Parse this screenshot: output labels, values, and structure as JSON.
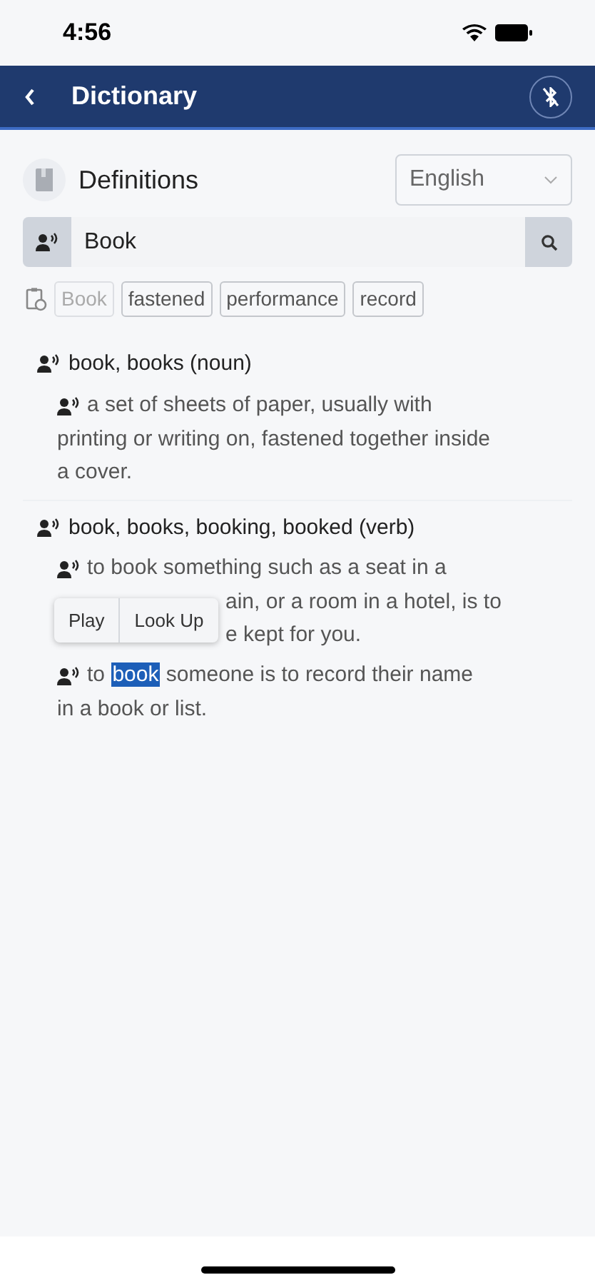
{
  "status_bar": {
    "time": "4:56"
  },
  "header": {
    "title": "Dictionary"
  },
  "section": {
    "title": "Definitions",
    "language": "English"
  },
  "search": {
    "value": "Book"
  },
  "history": [
    {
      "label": "Book",
      "selected": true
    },
    {
      "label": "fastened",
      "selected": false
    },
    {
      "label": "performance",
      "selected": false
    },
    {
      "label": "record",
      "selected": false
    }
  ],
  "entries": [
    {
      "heading": "book, books (noun)",
      "definitions": [
        {
          "lines": [
            {
              "segments": [
                {
                  "text": "a set of sheets of paper, usually with",
                  "selected": false
                }
              ]
            },
            {
              "segments": [
                {
                  "text": "printing or writing on, fastened together inside",
                  "selected": false
                }
              ]
            },
            {
              "segments": [
                {
                  "text": "a cover.",
                  "selected": false
                }
              ]
            }
          ]
        }
      ]
    },
    {
      "heading": "book, books, booking, booked (verb)",
      "definitions": [
        {
          "lines": [
            {
              "segments": [
                {
                  "text": "to book something such as a seat in a",
                  "selected": false
                }
              ]
            },
            {
              "covered": true,
              "segments": [
                {
                  "text": "ain, or a room in a hotel, is to",
                  "selected": false
                }
              ]
            },
            {
              "covered": true,
              "segments": [
                {
                  "text": "e kept for you.",
                  "selected": false
                }
              ]
            }
          ]
        },
        {
          "lines": [
            {
              "segments": [
                {
                  "text": "to",
                  "selected": false
                },
                {
                  "text": "book",
                  "selected": true
                },
                {
                  "text": "someone is to record their name",
                  "selected": false
                }
              ]
            },
            {
              "segments": [
                {
                  "text": "in a book or list.",
                  "selected": false
                }
              ]
            }
          ]
        }
      ]
    }
  ],
  "popup": {
    "actions": [
      "Play",
      "Look Up"
    ]
  }
}
